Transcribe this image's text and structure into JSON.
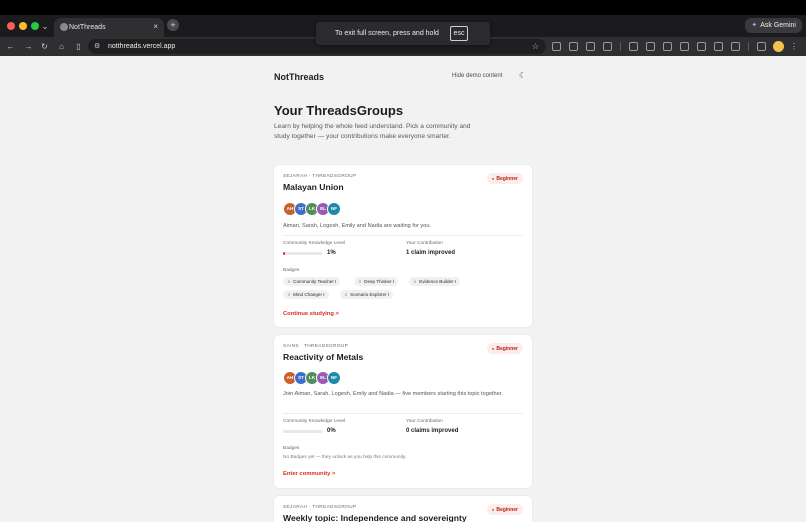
{
  "browser": {
    "tab_title": "NotThreads",
    "tab_close": "×",
    "new_tab": "+",
    "ask_gemini": "Ask Gemini",
    "url": "notthreads.vercel.app",
    "fullscreen_toast_text": "To exit full screen, press and hold",
    "fullscreen_toast_key": "esc"
  },
  "header": {
    "brand": "NotThreads",
    "hide_demo": "Hide demo content"
  },
  "main": {
    "title": "Your ThreadsGroups",
    "intro": "Learn by helping the whole feed understand. Pick a community and study together — your contributions make everyone smarter."
  },
  "cards": [
    {
      "eyebrow": "SEJARAH · THREADSGROUP",
      "level": "Beginner",
      "title": "Malayan Union",
      "avatars": [
        {
          "initials": "AH",
          "color": "#c8622c"
        },
        {
          "initials": "ST",
          "color": "#3d6fc9"
        },
        {
          "initials": "LK",
          "color": "#4f8f5a"
        },
        {
          "initials": "EL",
          "color": "#9b59b6"
        },
        {
          "initials": "NF",
          "color": "#1f8aa8"
        }
      ],
      "description": "Aiman, Sarah, Logesh, Emily and Nadia are waiting for you.",
      "knowledge_label": "Community Knowledge Level",
      "knowledge_pct": "1%",
      "knowledge_value": 0.01,
      "contribution_label": "Your Contribution",
      "contribution_value": "1 claim improved",
      "badges_label": "Badges",
      "badges": [
        "Community Teacher I",
        "Deep Thinker I",
        "Evidence Builder I",
        "Mind Changer I",
        "Scenario Explorer I"
      ],
      "cta": "Continue studying",
      "cta_arrow": ">"
    },
    {
      "eyebrow": "SAINS · THREADSGROUP",
      "level": "Beginner",
      "title": "Reactivity of Metals",
      "avatars": [
        {
          "initials": "AH",
          "color": "#c8622c"
        },
        {
          "initials": "ST",
          "color": "#3d6fc9"
        },
        {
          "initials": "LK",
          "color": "#4f8f5a"
        },
        {
          "initials": "EL",
          "color": "#9b59b6"
        },
        {
          "initials": "NF",
          "color": "#1f8aa8"
        }
      ],
      "description": "Join Aiman, Sarah, Logesh, Emily and Nadia — five members starting this topic together.",
      "knowledge_label": "Community Knowledge Level",
      "knowledge_pct": "0%",
      "knowledge_value": 0,
      "contribution_label": "Your Contribution",
      "contribution_value": "0 claims improved",
      "badges_label": "Badges",
      "no_badges": "No Badges yet — they unlock as you help this community.",
      "cta": "Enter community",
      "cta_arrow": ">"
    },
    {
      "eyebrow": "SEJARAH · THREADSGROUP",
      "level": "Beginner",
      "title": "Weekly topic: Independence and sovereignty"
    }
  ],
  "colors": {
    "accent": "#d92d20",
    "page_bg": "#f2f2f3",
    "card_bg": "#ffffff",
    "beginner_pill_bg": "#fdecec"
  }
}
